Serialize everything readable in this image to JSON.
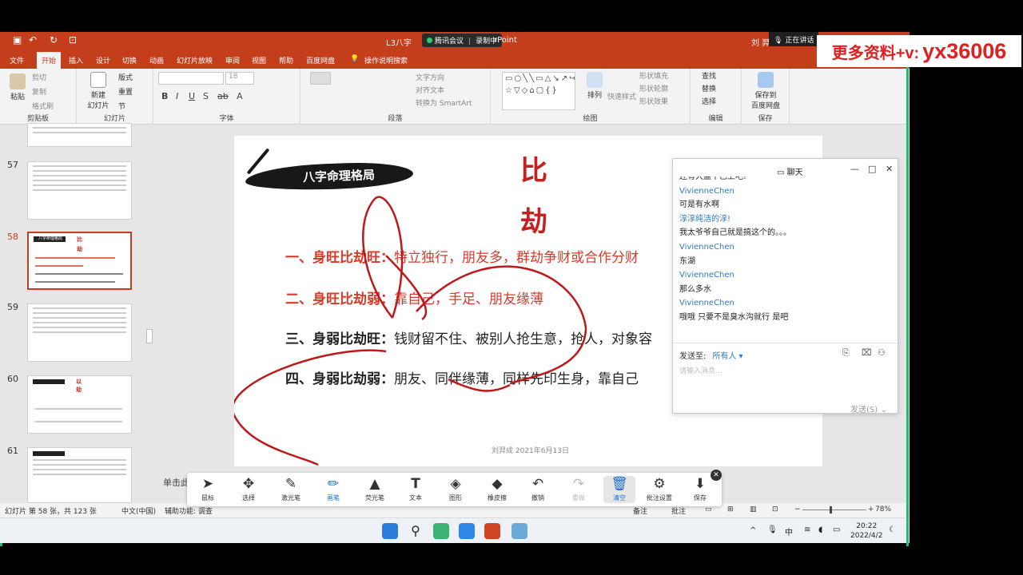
{
  "ad": {
    "text1": "更多资料+v:",
    "text2": "yx36006"
  },
  "titlebar": {
    "doc": "L3八字",
    "doc_suffix": "rPoint",
    "meeting_app": "腾讯会议",
    "recording": "录制中",
    "user": "刘 羿",
    "speaking": "正在讲话"
  },
  "menu": [
    "文件",
    "开始",
    "插入",
    "设计",
    "切换",
    "动画",
    "幻灯片放映",
    "审阅",
    "视图",
    "帮助",
    "百度网盘",
    "操作说明搜索"
  ],
  "ribbon": {
    "groups": [
      "剪贴板",
      "幻灯片",
      "字体",
      "段落",
      "绘图",
      "编辑",
      "保存"
    ],
    "paste": "粘贴",
    "cut": "剪切",
    "copy": "复制",
    "format_painter": "格式刷",
    "new_slide": "新建",
    "new_slide2": "幻灯片",
    "layout": "版式",
    "reset": "重置",
    "section": "节",
    "font_size": "18",
    "text_direction": "文字方向",
    "align_text": "对齐文本",
    "smartart": "转换为 SmartArt",
    "arrange": "排列",
    "quick_styles": "快速样式",
    "shape_fill": "形状填充",
    "shape_outline": "形状轮廓",
    "shape_effects": "形状效果",
    "find": "查找",
    "replace": "替换",
    "select": "选择",
    "save_to": "保存到",
    "baidu": "百度网盘"
  },
  "thumbs": {
    "numbers": [
      "57",
      "58",
      "59",
      "60",
      "61"
    ],
    "selected": "58",
    "t58_title": "八字命理格局",
    "t58_char": "比",
    "t58_char2": "劫",
    "t60_char": "以",
    "t60_char2": "劫"
  },
  "slide": {
    "banner": "八字命理格局",
    "char1": "比",
    "char2": "劫",
    "lines": [
      {
        "head": "一、身旺比劫旺：",
        "body": "特立独行，朋友多，群劫争财或合作分财"
      },
      {
        "head": "二、身旺比劫弱：",
        "body": "靠自己，手足、朋友缘薄"
      },
      {
        "head": "三、身弱比劫旺：",
        "body": "钱财留不住、被别人抢生意，抢人，对象容"
      },
      {
        "head": "四、身弱比劫弱：",
        "body": "朋友、同伴缘薄，同样先印生身，靠自己"
      }
    ],
    "footer": "刘羿成 2021年6月13日",
    "colors": {
      "accent": "#d63a2a",
      "char": "#c62020",
      "ink": "#c01818"
    }
  },
  "notes_placeholder": "单击此",
  "drawbar": {
    "tools": [
      {
        "label": "鼠标",
        "icon": "cursor-icon"
      },
      {
        "label": "选择",
        "icon": "move-icon"
      },
      {
        "label": "激光笔",
        "icon": "laser-icon"
      },
      {
        "label": "画笔",
        "icon": "pen-icon"
      },
      {
        "label": "荧光笔",
        "icon": "highlighter-icon"
      },
      {
        "label": "文本",
        "icon": "text-icon"
      },
      {
        "label": "图形",
        "icon": "shape-icon"
      },
      {
        "label": "橡皮擦",
        "icon": "eraser-icon"
      },
      {
        "label": "撤销",
        "icon": "undo-icon"
      },
      {
        "label": "重做",
        "icon": "redo-icon"
      },
      {
        "label": "清空",
        "icon": "trash-icon"
      },
      {
        "label": "批注设置",
        "icon": "annot-settings-icon"
      },
      {
        "label": "保存",
        "icon": "save-icon"
      }
    ]
  },
  "chat": {
    "title": "聊天",
    "messages": [
      {
        "type": "text",
        "text": "还有大盖干已上吧!"
      },
      {
        "type": "sender",
        "text": "VivienneChen"
      },
      {
        "type": "text",
        "text": "可是有水啊"
      },
      {
        "type": "sender",
        "text": "淳淳纯洁的淳!"
      },
      {
        "type": "text",
        "text": "我太爷爷自己就是搞这个的。。。"
      },
      {
        "type": "sender",
        "text": "VivienneChen"
      },
      {
        "type": "text",
        "text": "东湖"
      },
      {
        "type": "sender",
        "text": "VivienneChen"
      },
      {
        "type": "text",
        "text": "那么多水"
      },
      {
        "type": "sender",
        "text": "VivienneChen"
      },
      {
        "type": "text",
        "text": "哦哦 只要不是臭水沟就行 是吧"
      }
    ],
    "send_to_label": "发送至:",
    "send_to_value": "所有人",
    "input_placeholder": "请输入消息...",
    "send_button": "发送(S)"
  },
  "status": {
    "slide_info": "幻灯片 第 58 张，共 123 张",
    "language": "中文(中国)",
    "accessibility": "辅助功能: 调查",
    "notes": "备注",
    "comments": "批注",
    "zoom": "78%"
  },
  "taskbar": {
    "time": "20:22",
    "date": "2022/4/2",
    "ime": "中"
  }
}
